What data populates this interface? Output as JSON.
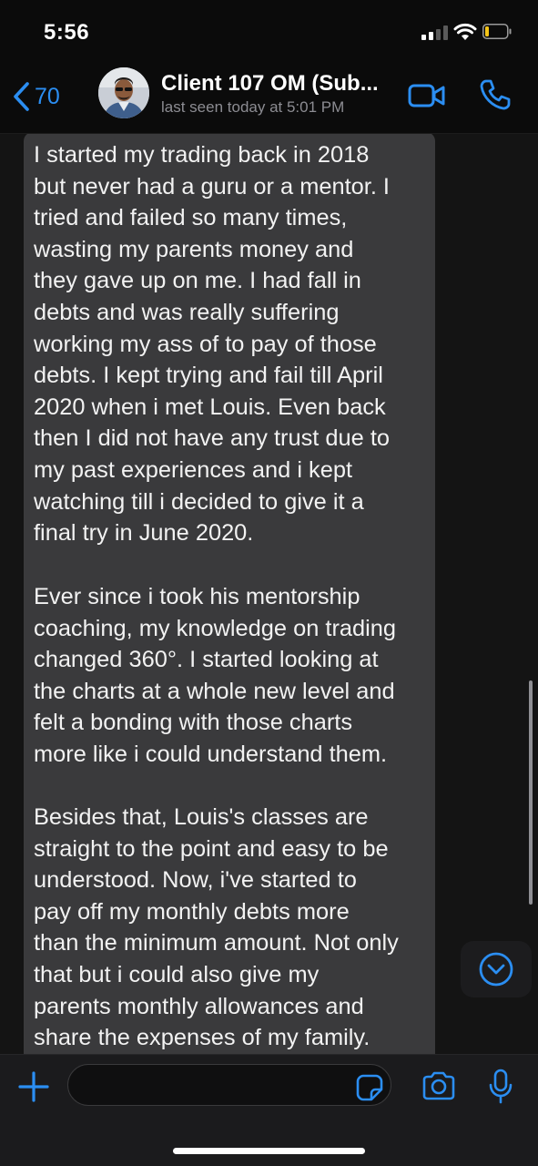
{
  "status_bar": {
    "time": "5:56"
  },
  "header": {
    "back_count": "70",
    "contact_name": "Client 107 OM (Sub...",
    "last_seen": "last seen today at 5:01 PM"
  },
  "message": {
    "paragraphs": [
      "I started my trading back in 2018\nbut never had a guru or a mentor. I\ntried and failed so many times,\nwasting my parents money and\nthey gave up on me. I had fall in\ndebts and was really suffering\nworking my ass of to pay of those\ndebts. I kept trying and fail till April\n2020 when i met Louis. Even back\nthen I did not have any trust due to\nmy past experiences  and i kept\nwatching till i decided to give it a\nfinal try in June 2020.",
      "Ever since i took his mentorship\ncoaching, my knowledge on trading\nchanged 360°. I started looking at\nthe charts at a whole new level and\nfelt a bonding with those charts\nmore like i could understand them.",
      "Besides that, Louis's classes are\nstraight to the point and easy to be\nunderstood. Now, i've started to\npay off my monthly debts more\nthan the minimum amount. Not only\nthat but i could also give my\nparents monthly allowances and\nshare the expenses of my family."
    ]
  },
  "input_bar": {
    "value": "",
    "placeholder": ""
  },
  "icons": {
    "back": "chevron-left-icon",
    "video": "video-camera-icon",
    "call": "phone-icon",
    "scroll_down": "chevron-down-circle-icon",
    "plus": "plus-icon",
    "sticker": "sticker-icon",
    "camera": "camera-icon",
    "mic": "microphone-icon"
  },
  "colors": {
    "accent": "#2b8ef2",
    "bubble": "#3a3a3c",
    "background": "#0b0b0b",
    "muted_text": "#8c8c92"
  }
}
